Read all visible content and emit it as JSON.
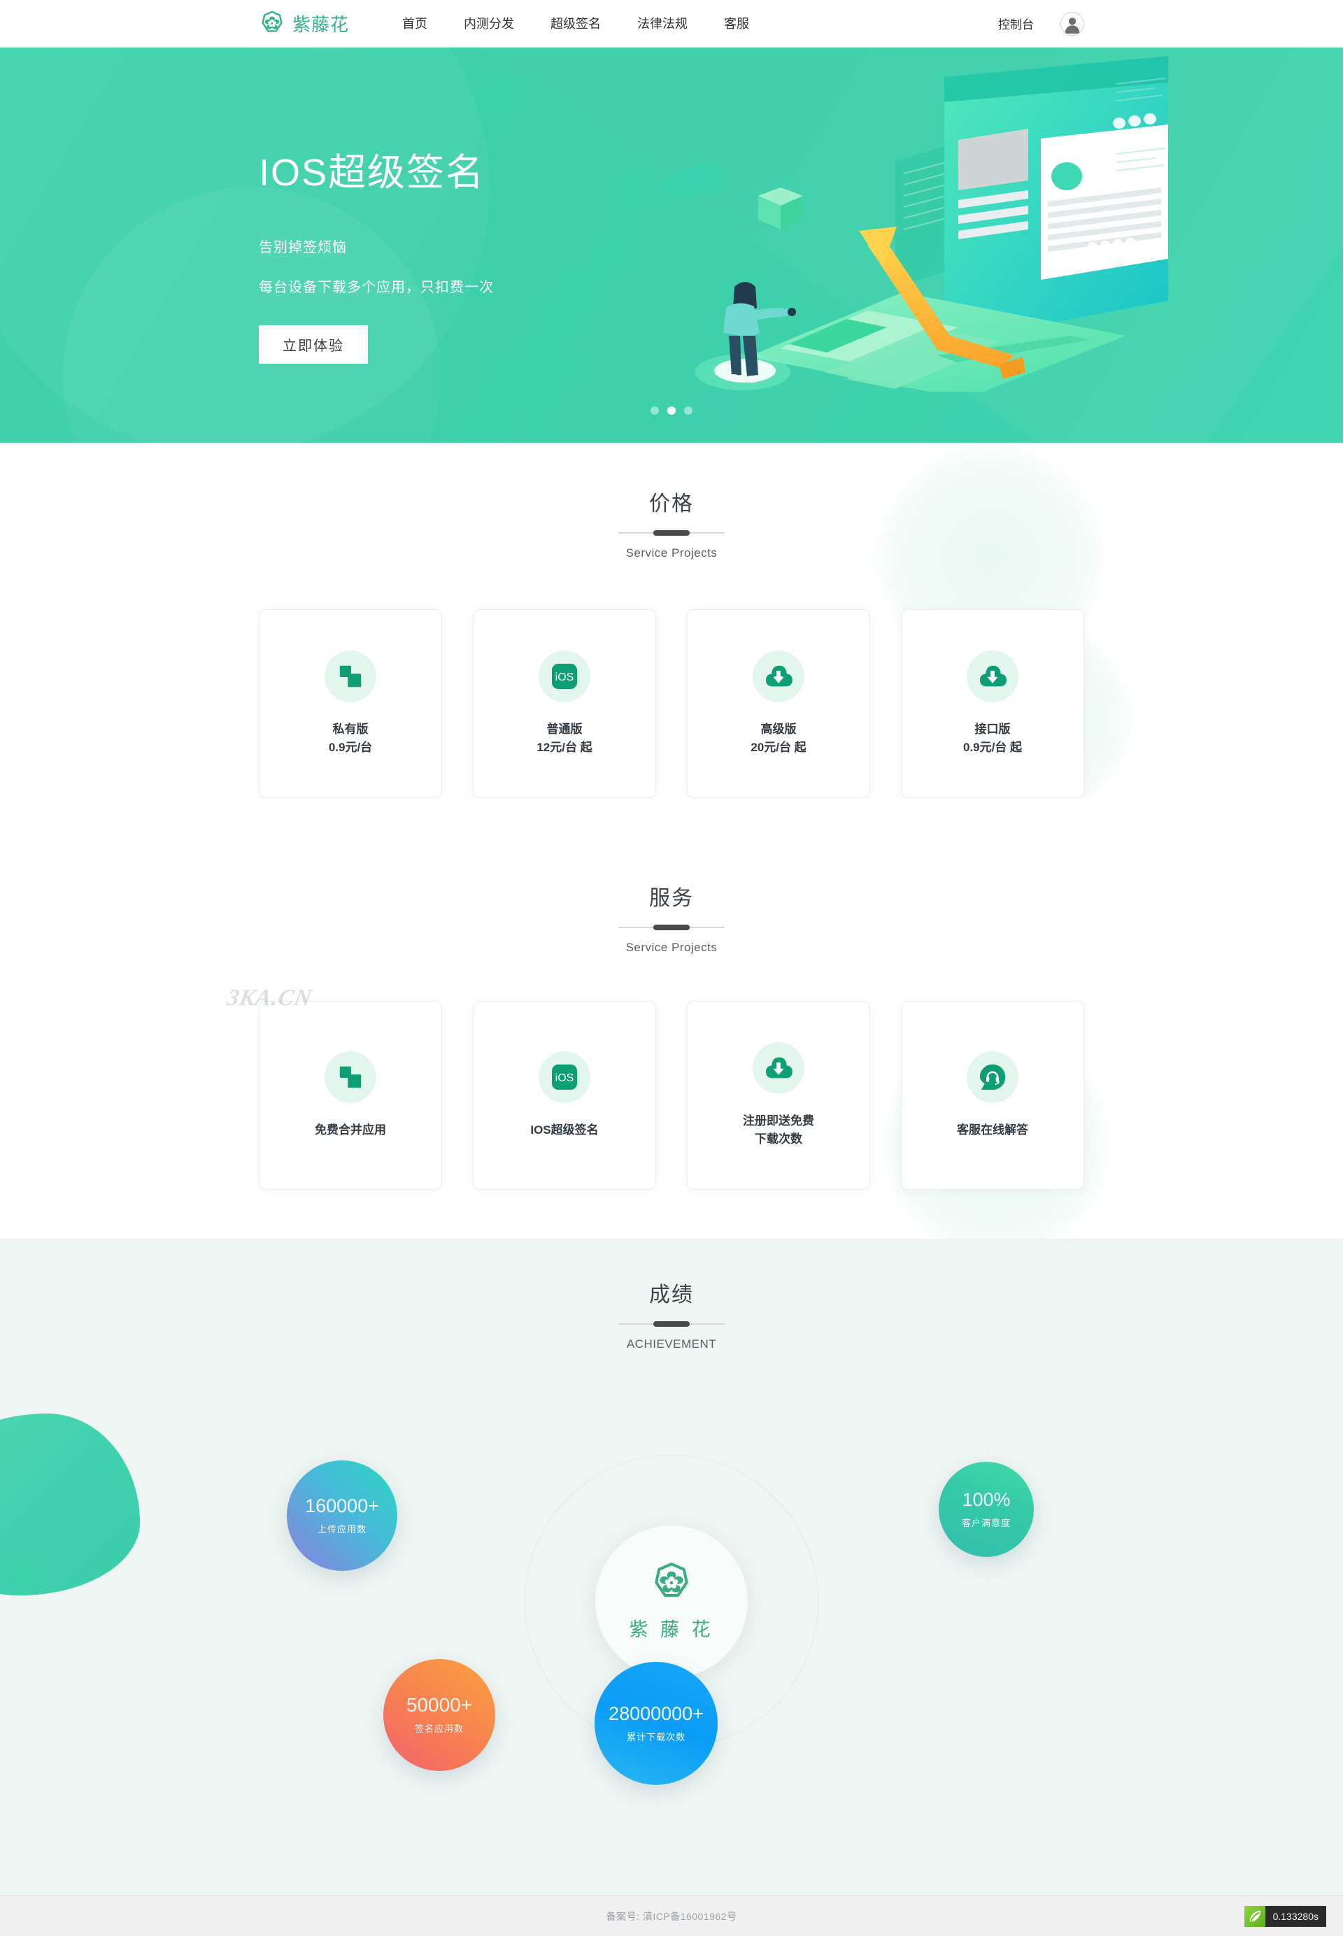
{
  "brand": {
    "name": "紫藤花",
    "logo_icon": "wisteria-flower-logo-icon",
    "color": "#35b28c"
  },
  "header": {
    "nav": [
      {
        "label": "首页",
        "name": "home"
      },
      {
        "label": "内测分发",
        "name": "beta-distribution"
      },
      {
        "label": "超级签名",
        "name": "super-signature"
      },
      {
        "label": "法律法规",
        "name": "legal"
      },
      {
        "label": "客服",
        "name": "support"
      }
    ],
    "console_label": "控制台",
    "avatar_icon": "user-avatar-icon"
  },
  "hero": {
    "title": "IOS超级签名",
    "subtitle_1": "告别掉签烦恼",
    "subtitle_2": "每台设备下载多个应用，只扣费一次",
    "cta_label": "立即体验",
    "background_color": "#3ed1ac",
    "slides": 3,
    "active_slide": 2,
    "illustration_icon": "isometric-mobile-desktop-growth-illustration"
  },
  "pricing": {
    "title_cn": "价格",
    "title_en": "Service Projects",
    "cards": [
      {
        "icon": "stacked-squares-icon",
        "title": "私有版",
        "price": "0.9元/台"
      },
      {
        "icon": "ios-app-icon",
        "title": "普通版",
        "price": "12元/台 起"
      },
      {
        "icon": "cloud-download-icon",
        "title": "高级版",
        "price": "20元/台 起"
      },
      {
        "icon": "cloud-download-icon",
        "title": "接口版",
        "price": "0.9元/台 起"
      }
    ]
  },
  "services": {
    "title_cn": "服务",
    "title_en": "Service Projects",
    "watermark": "3KA.CN",
    "cards": [
      {
        "icon": "stacked-squares-icon",
        "title": "免费合并应用",
        "title_line2": ""
      },
      {
        "icon": "ios-app-icon",
        "title": "IOS超级签名",
        "title_line2": ""
      },
      {
        "icon": "cloud-download-icon",
        "title": "注册即送免费",
        "title_line2": "下载次数"
      },
      {
        "icon": "headset-support-icon",
        "title": "客服在线解答",
        "title_line2": ""
      }
    ]
  },
  "achievement": {
    "title_cn": "成绩",
    "title_en": "ACHIEVEMENT",
    "center_label": "紫 藤 花",
    "center_icon": "wisteria-flower-logo-icon",
    "bubbles": [
      {
        "name": "uploads",
        "value": "160000+",
        "label": "上传应用数",
        "color_from": "#2ad6c3",
        "color_to": "#8b7fe0"
      },
      {
        "name": "satisfaction",
        "value": "100%",
        "label": "客户满意度",
        "color_from": "#3fd9a8",
        "color_to": "#33bfae"
      },
      {
        "name": "signed",
        "value": "50000+",
        "label": "签名应用数",
        "color_from": "#fba23f",
        "color_to": "#f0636e"
      },
      {
        "name": "downloads",
        "value": "28000000+",
        "label": "累计下载次数",
        "color_from": "#17a6f5",
        "color_to": "#2ab8f0"
      }
    ]
  },
  "footer": {
    "icp_text": "备案号: 滇ICP备16001962号",
    "debug_time": "0.133280s",
    "debug_icon": "thinkphp-leaf-icon"
  }
}
